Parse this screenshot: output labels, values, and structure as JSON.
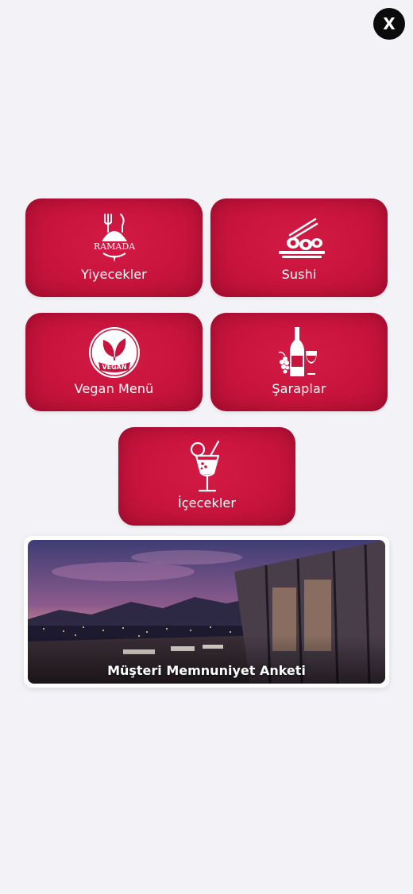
{
  "close": {
    "label": "X"
  },
  "tiles": [
    {
      "label": "Yiyecekler",
      "icon": "ramada-food-icon",
      "logo_text": "RAMADA"
    },
    {
      "label": "Sushi",
      "icon": "sushi-icon"
    },
    {
      "label": "Vegan Menü",
      "icon": "vegan-icon",
      "badge_text": "VEGAN"
    },
    {
      "label": "Şaraplar",
      "icon": "wine-icon"
    },
    {
      "label": "İçecekler",
      "icon": "cocktail-icon"
    }
  ],
  "banner": {
    "label": "Müşteri Memnuniyet Anketi",
    "image": "rooftop-restaurant-sunset-photo"
  },
  "colors": {
    "background": "#f3f3f7",
    "tile": "#c8143d",
    "close_button": "#0b0b0b"
  }
}
